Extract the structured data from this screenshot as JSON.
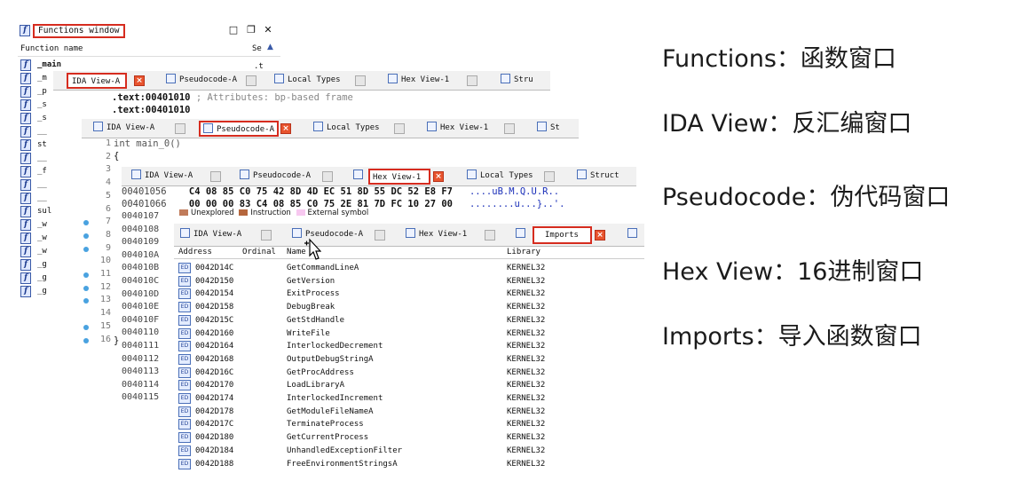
{
  "functions_window": {
    "title": "Functions window",
    "col_name": "Function name",
    "col_segment": "Se",
    "segment_main": ".t",
    "items": [
      "_main",
      "_m",
      "_p",
      "_s",
      "_s",
      "__",
      "st",
      "__",
      "_f",
      "__",
      "__",
      "sul",
      "_w",
      "_w",
      "_w",
      "_g",
      "_g",
      "_g"
    ]
  },
  "ida_view": {
    "line1_addr": ".text:00401010",
    "line1_comment": "; Attributes: bp-based frame",
    "line2_addr": ".text:00401010"
  },
  "tabs": {
    "ida_view": "IDA View-A",
    "pseudocode": "Pseudocode-A",
    "local_types": "Local Types",
    "hex_view": "Hex View-1",
    "structures_short1": "Stru",
    "structures_short2": "St",
    "structures": "Struct",
    "imports": "Imports"
  },
  "pseudocode": {
    "line_numbers": [
      "1",
      "2",
      "3",
      "4",
      "5",
      "6",
      "7",
      "8",
      "9",
      "10",
      "11",
      "12",
      "13",
      "14",
      "15",
      "16"
    ],
    "line1": "int main_0()",
    "line2": "{",
    "line16": "}"
  },
  "hex_view": {
    "rows": [
      {
        "addr": "00401056",
        "bytes": "C4 08 85 C0 75 42 8D 4D  EC 51 8D 55 DC 52 E8 F7",
        "ascii": "....uB.M.Q.U.R.."
      },
      {
        "addr": "00401066",
        "bytes": "00 00 00 83 C4 08 85 C0  75 2E 81 7D FC 10 27 00",
        "ascii": "........u...}..'."
      }
    ],
    "partial_addresses": [
      "0040107",
      "0040108",
      "0040109",
      "004010A",
      "004010B",
      "004010C",
      "004010D",
      "004010E",
      "004010F",
      "0040110",
      "0040111",
      "0040112",
      "0040113",
      "0040114",
      "0040115"
    ],
    "legend_unexplored": "Unexplored",
    "legend_instruction": "Instruction",
    "legend_external": "External symbol",
    "color_unexplored": "#c07b5a",
    "color_instruction": "#b5663d",
    "color_external": "#f7c8f0"
  },
  "imports": {
    "col_address": "Address",
    "col_ordinal": "Ordinal",
    "col_name": "Name",
    "col_library": "Library",
    "rows": [
      {
        "address": "0042D14C",
        "name": "GetCommandLineA",
        "library": "KERNEL32"
      },
      {
        "address": "0042D150",
        "name": "GetVersion",
        "library": "KERNEL32"
      },
      {
        "address": "0042D154",
        "name": "ExitProcess",
        "library": "KERNEL32"
      },
      {
        "address": "0042D158",
        "name": "DebugBreak",
        "library": "KERNEL32"
      },
      {
        "address": "0042D15C",
        "name": "GetStdHandle",
        "library": "KERNEL32"
      },
      {
        "address": "0042D160",
        "name": "WriteFile",
        "library": "KERNEL32"
      },
      {
        "address": "0042D164",
        "name": "InterlockedDecrement",
        "library": "KERNEL32"
      },
      {
        "address": "0042D168",
        "name": "OutputDebugStringA",
        "library": "KERNEL32"
      },
      {
        "address": "0042D16C",
        "name": "GetProcAddress",
        "library": "KERNEL32"
      },
      {
        "address": "0042D170",
        "name": "LoadLibraryA",
        "library": "KERNEL32"
      },
      {
        "address": "0042D174",
        "name": "InterlockedIncrement",
        "library": "KERNEL32"
      },
      {
        "address": "0042D178",
        "name": "GetModuleFileNameA",
        "library": "KERNEL32"
      },
      {
        "address": "0042D17C",
        "name": "TerminateProcess",
        "library": "KERNEL32"
      },
      {
        "address": "0042D180",
        "name": "GetCurrentProcess",
        "library": "KERNEL32"
      },
      {
        "address": "0042D184",
        "name": "UnhandledExceptionFilter",
        "library": "KERNEL32"
      },
      {
        "address": "0042D188",
        "name": "FreeEnvironmentStringsA",
        "library": "KERNEL32"
      }
    ]
  },
  "notes": [
    "Functions：函数窗口",
    "IDA View：反汇编窗口",
    "Pseudocode：伪代码窗口",
    "Hex View：16进制窗口",
    "Imports：导入函数窗口"
  ],
  "colors": {
    "highlight_red": "#d62c1f",
    "close_button": "#e8542e",
    "breakpoint_dot": "#49a2e0",
    "ascii_blue": "#1a2fb8"
  }
}
